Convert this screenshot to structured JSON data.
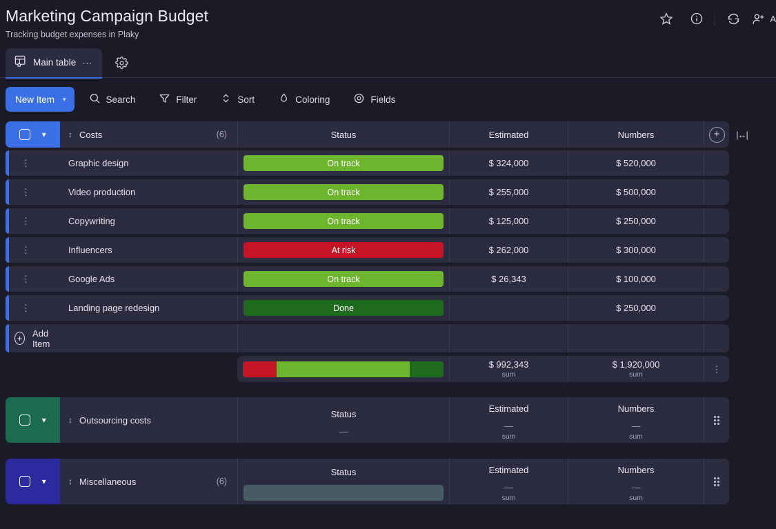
{
  "header": {
    "title": "Marketing Campaign Budget",
    "subtitle": "Tracking budget expenses in Plaky",
    "actions": [
      {
        "name": "favorite-star-icon",
        "label": "Favorite"
      },
      {
        "name": "info-icon",
        "label": "Info"
      },
      {
        "name": "activity-refresh-icon",
        "label": "Activity"
      }
    ],
    "invite_label": "A"
  },
  "tabs": [
    {
      "label": "Main table",
      "icon": "table-home-icon",
      "more": "⋯",
      "active": true
    }
  ],
  "settings_label": "Settings",
  "toolbar": {
    "new_item_label": "New Item",
    "new_item_caret": "▾",
    "items": [
      {
        "label": "Search",
        "icon": "search-icon"
      },
      {
        "label": "Filter",
        "icon": "filter-icon"
      },
      {
        "label": "Sort",
        "icon": "sort-icon"
      },
      {
        "label": "Coloring",
        "icon": "coloring-drop-icon"
      },
      {
        "label": "Fields",
        "icon": "fields-eye-icon"
      }
    ]
  },
  "main_group": {
    "name": "Costs",
    "count": "(6)",
    "accent_color": "#3b6fe8",
    "columns": [
      "Status",
      "Estimated",
      "Numbers"
    ],
    "add_column_label": "+",
    "resize_label": "|↔|",
    "rows": [
      {
        "name": "Graphic design",
        "status": "On track",
        "status_color": "#6cb52d",
        "estimated": "$ 324,000",
        "numbers": "$ 520,000"
      },
      {
        "name": "Video production",
        "status": "On track",
        "status_color": "#6cb52d",
        "estimated": "$ 255,000",
        "numbers": "$ 500,000"
      },
      {
        "name": "Copywriting",
        "status": "On track",
        "status_color": "#6cb52d",
        "estimated": "$ 125,000",
        "numbers": "$ 250,000"
      },
      {
        "name": "Influencers",
        "status": "At risk",
        "status_color": "#c41425",
        "estimated": "$ 262,000",
        "numbers": "$ 300,000"
      },
      {
        "name": "Google Ads",
        "status": "On track",
        "status_color": "#6cb52d",
        "estimated": "$ 26,343",
        "numbers": "$ 100,000"
      },
      {
        "name": "Landing page redesign",
        "status": "Done",
        "status_color": "#1e6b1e",
        "estimated": "",
        "numbers": "$ 250,000"
      }
    ],
    "add_item_label": "Add Item",
    "summary": {
      "status_segments": [
        {
          "label": "At risk",
          "color": "#c41425",
          "pct": 17
        },
        {
          "label": "On track",
          "color": "#6cb52d",
          "pct": 66
        },
        {
          "label": "Done",
          "color": "#1e6b1e",
          "pct": 17
        }
      ],
      "estimated_value": "$ 992,343",
      "estimated_sub": "sum",
      "numbers_value": "$ 1,920,000",
      "numbers_sub": "sum"
    }
  },
  "groups": [
    {
      "name": "Outsourcing costs",
      "count": "",
      "accent_color": "#1c6b51",
      "columns": [
        "Status",
        "Estimated",
        "Numbers"
      ],
      "status_value": "—",
      "status_placeholder_color": "",
      "estimated_value": "—",
      "estimated_sub": "sum",
      "numbers_value": "—",
      "numbers_sub": "sum"
    },
    {
      "name": "Miscellaneous",
      "count": "(6)",
      "accent_color": "#2b2b9e",
      "columns": [
        "Status",
        "Estimated",
        "Numbers"
      ],
      "status_value": "",
      "status_placeholder_color": "#475b66",
      "estimated_value": "—",
      "estimated_sub": "sum",
      "numbers_value": "—",
      "numbers_sub": "sum"
    }
  ]
}
